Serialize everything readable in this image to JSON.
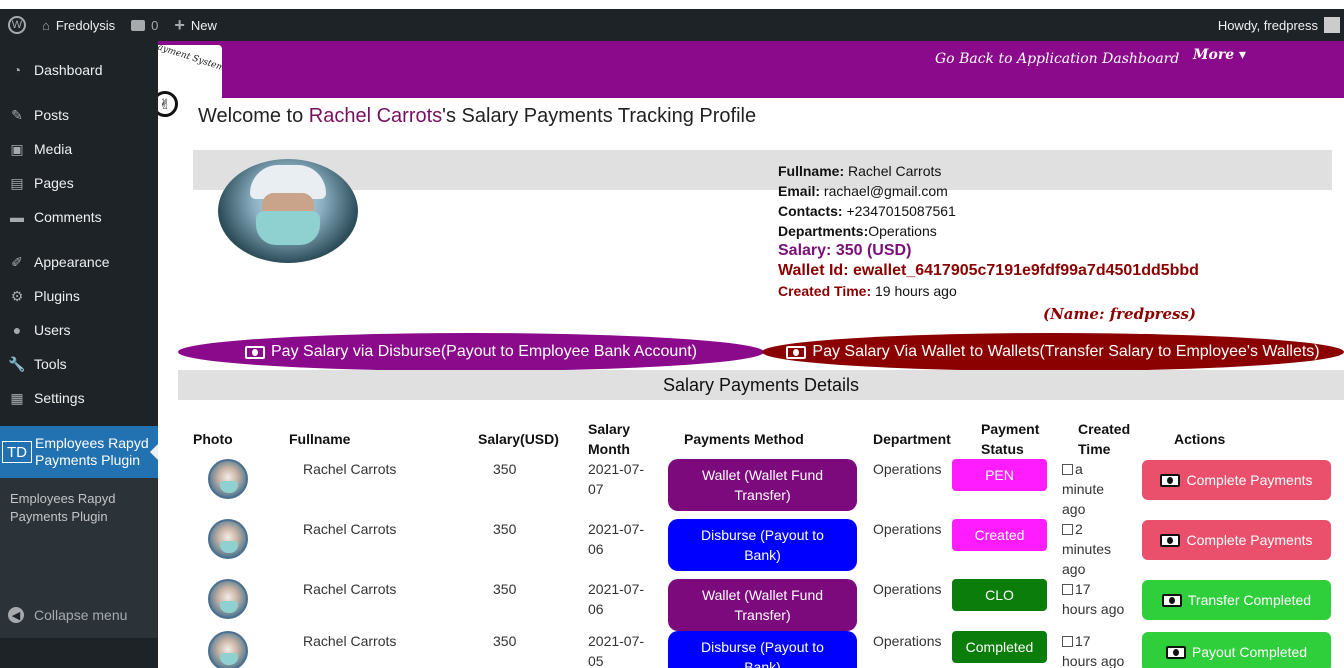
{
  "adminbar": {
    "site_name": "Fredolysis",
    "comments_count": "0",
    "new_label": "New",
    "howdy": "Howdy, fredpress"
  },
  "sidebar": {
    "items": [
      {
        "label": "Dashboard",
        "icon": "dashboard-icon"
      },
      {
        "label": "Posts",
        "icon": "pin-icon"
      },
      {
        "label": "Media",
        "icon": "media-icon"
      },
      {
        "label": "Pages",
        "icon": "pages-icon"
      },
      {
        "label": "Comments",
        "icon": "comment-icon"
      },
      {
        "label": "Appearance",
        "icon": "brush-icon"
      },
      {
        "label": "Plugins",
        "icon": "plugin-icon"
      },
      {
        "label": "Users",
        "icon": "users-icon"
      },
      {
        "label": "Tools",
        "icon": "wrench-icon"
      },
      {
        "label": "Settings",
        "icon": "settings-icon"
      }
    ],
    "active": {
      "badge": "TD",
      "label_line1": "Employees Rapyd",
      "label_line2": "Payments Plugin"
    },
    "submenu": {
      "line1": "Employees Rapyd",
      "line2": "Payments Plugin"
    },
    "collapse_label": "Collapse menu"
  },
  "header": {
    "logo_text": "ayment System",
    "go_back": "Go Back to Application Dashboard",
    "more": "More ▾"
  },
  "welcome": {
    "prefix": "Welcome to ",
    "name": "Rachel Carrots",
    "suffix": "'s Salary Payments Tracking Profile"
  },
  "profile": {
    "fullname_label": "Fullname:",
    "fullname": " Rachel Carrots",
    "email_label": "Email:",
    "email": " rachael@gmail.com",
    "contacts_label": "Contacts:",
    "contacts": " +2347015087561",
    "departments_label": "Departments:",
    "departments": "Operations",
    "salary": "Salary: 350 (USD)",
    "wallet": "Wallet Id: ewallet_6417905c7191e9fdf99a7d4501dd5bbd",
    "created_label": "Created Time:",
    "created": " 19 hours ago",
    "name_note": "(Name: fredpress)"
  },
  "buttons": {
    "pay_disburse": "Pay Salary via Disburse(Payout to Employee Bank Account)",
    "pay_wallet": "Pay Salary Via Wallet to Wallets(Transfer Salary to Employee's Wallets)"
  },
  "details_title": "Salary Payments Details",
  "table": {
    "headers": {
      "photo": "Photo",
      "fullname": "Fullname",
      "salary": "Salary(USD)",
      "month_l1": "Salary",
      "month_l2": "Month",
      "method": "Payments Method",
      "department": "Department",
      "status_l1": "Payment",
      "status_l2": "Status",
      "created_l1": "Created",
      "created_l2": "Time",
      "actions": "Actions"
    },
    "rows": [
      {
        "name": "Rachel Carrots",
        "salary": "350",
        "month_l1": "2021-07-",
        "month_l2": "07",
        "method_l1": "Wallet (Wallet Fund",
        "method_l2": "Transfer)",
        "method_color": "#7d0a7d",
        "department": "Operations",
        "status": "PEN",
        "status_color": "#ff1cff",
        "time_l1": "a",
        "time_l2": "minute",
        "time_l3": "ago",
        "action": "Complete Payments",
        "action_kind": "red"
      },
      {
        "name": "Rachel Carrots",
        "salary": "350",
        "month_l1": "2021-07-",
        "month_l2": "06",
        "method_l1": "Disburse (Payout to",
        "method_l2": "Bank)",
        "method_color": "#0000ff",
        "department": "Operations",
        "status": "Created",
        "status_color": "#ff1cff",
        "time_l1": "2",
        "time_l2": "minutes",
        "time_l3": "ago",
        "action": "Complete Payments",
        "action_kind": "red"
      },
      {
        "name": "Rachel Carrots",
        "salary": "350",
        "month_l1": "2021-07-",
        "month_l2": "06",
        "method_l1": "Wallet (Wallet Fund",
        "method_l2": "Transfer)",
        "method_color": "#7d0a7d",
        "department": "Operations",
        "status": "CLO",
        "status_color": "#0b7d0b",
        "time_l1": "17",
        "time_l2": "hours ago",
        "time_l3": "",
        "action": "Transfer Completed",
        "action_kind": "green"
      },
      {
        "name": "Rachel Carrots",
        "salary": "350",
        "month_l1": "2021-07-",
        "month_l2": "05",
        "method_l1": "Disburse (Payout to",
        "method_l2": "Bank)",
        "method_color": "#0000ff",
        "department": "Operations",
        "status": "Completed",
        "status_color": "#0b7d0b",
        "time_l1": "17",
        "time_l2": "hours ago",
        "time_l3": "",
        "action": "Payout Completed",
        "action_kind": "green"
      }
    ]
  }
}
